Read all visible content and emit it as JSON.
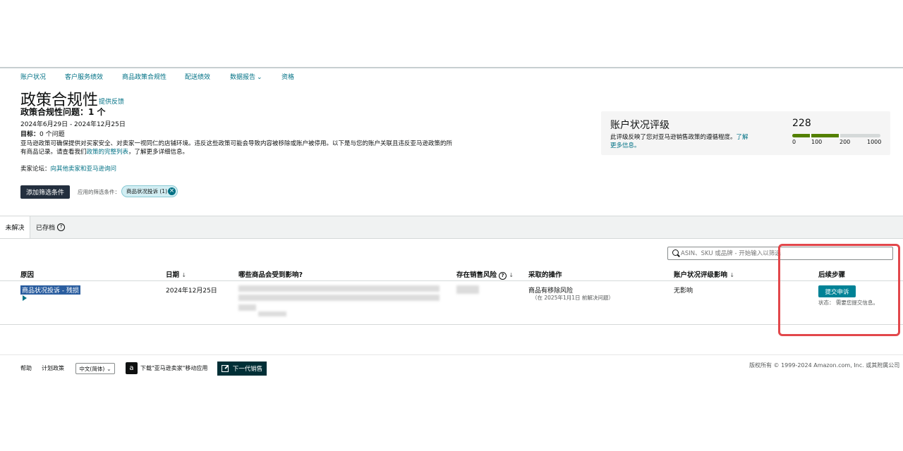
{
  "nav": {
    "items": [
      {
        "label": "账户状况"
      },
      {
        "label": "客户服务绩效"
      },
      {
        "label": "商品政策合规性"
      },
      {
        "label": "配送绩效"
      },
      {
        "label": "数据报告"
      },
      {
        "label": "资格"
      }
    ],
    "dropdown_marker": "⌄"
  },
  "header": {
    "title": "政策合规性",
    "feedback_link": "提供反馈",
    "issues_count": "政策合规性问题：1 个",
    "date_range": "2024年6月29日 - 2024年12月25日",
    "target_label": "目标：",
    "target_value": "0 个问题",
    "description_1": "亚马逊政策可确保提供对买家安全、对卖家一视同仁的店铺环境。违反这些政策可能会导致内容被移除或账户被停用。以下是与您的账户关联且违反亚马逊政策的所有商品记录。请查看我们",
    "description_link": "政策的完整列表",
    "description_2": "，了解更多详细信息。",
    "forum_label": "卖家论坛：",
    "forum_link": "向其他卖家和亚马逊询问"
  },
  "filters": {
    "add_button": "添加筛选条件",
    "applied_label": "应用的筛选条件：",
    "chip_label": "商品状况投诉 (1)",
    "chip_close": "×"
  },
  "health_card": {
    "title": "账户状况评级",
    "description_1": "此评级反映了您对亚马逊销售政策的遵循程度。",
    "description_link": "了解更多信息。",
    "score": "228",
    "score_value": 228,
    "scale_max": 1000,
    "scale_labels": [
      "0",
      "100",
      "200",
      "1000"
    ],
    "fill_color": "#538000"
  },
  "tabs": {
    "unresolved": "未解决",
    "archived": "已存档",
    "help_glyph": "?"
  },
  "search": {
    "placeholder": "ASIN、SKU 或品牌 - 开始输入以筛选"
  },
  "table": {
    "headers": {
      "reason": "原因",
      "date": "日期",
      "affected": "哪些商品会受到影响?",
      "at_risk": "存在销售风险",
      "action": "采取的操作",
      "impact": "账户状况评级影响",
      "next_steps": "后续步骤"
    },
    "sort_glyph": "↓",
    "row": {
      "reason": "商品状况投诉 - 残损",
      "date": "2024年12月25日",
      "action": "商品有移除风险",
      "action_sub": "（在 2025年1月1日 前解决问题）",
      "impact": "无影响",
      "submit_button": "提交申诉",
      "status": "状态： 需要您提交信息。"
    }
  },
  "footer": {
    "help": "帮助",
    "program_policy": "计划政策",
    "language": "中文(简体)",
    "app_icon_glyph": "a",
    "app_download": "下载\"亚马逊卖家\"移动应用",
    "next_button": "下一代销售",
    "copyright": "版权所有 © 1999-2024 Amazon.com, Inc. 或其附属公司"
  },
  "colors": {
    "link": "#007185",
    "dark_button": "#232f3e",
    "teal_button": "#008296",
    "highlight_box": "#e2474b"
  }
}
